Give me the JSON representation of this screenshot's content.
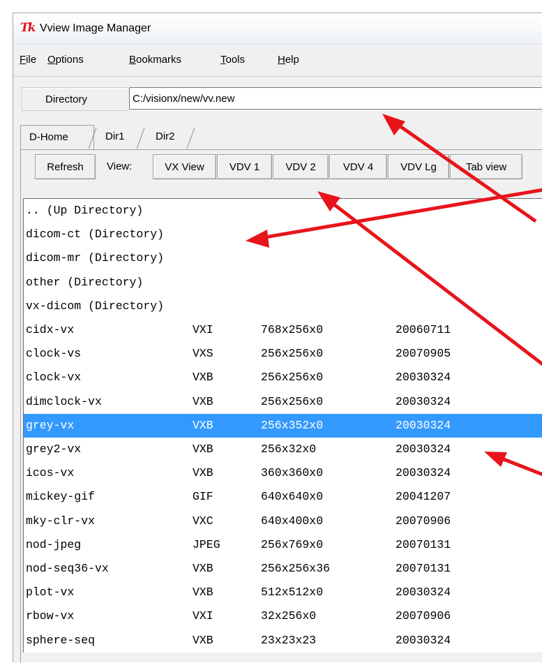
{
  "window": {
    "title": "Vview Image Manager",
    "app_icon": "Tk"
  },
  "menu": [
    {
      "label": "File",
      "accel": "F",
      "rest": "ile"
    },
    {
      "label": "Options",
      "accel": "O",
      "rest": "ptions"
    },
    {
      "label": "Bookmarks",
      "accel": "B",
      "rest": "ookmarks"
    },
    {
      "label": "Tools",
      "accel": "T",
      "rest": "ools"
    },
    {
      "label": "Help",
      "accel": "H",
      "rest": "elp"
    }
  ],
  "directory": {
    "label": "Directory",
    "value": "C:/visionx/new/vv.new"
  },
  "tabs": [
    "D-Home",
    "Dir1",
    "Dir2"
  ],
  "toolbar": {
    "refresh": "Refresh",
    "view_label": "View:",
    "buttons": [
      "VX View",
      "VDV 1",
      "VDV 2",
      "VDV 4",
      "VDV Lg",
      "Tab view"
    ]
  },
  "files": [
    {
      "name": ".. (Up Directory)",
      "type": "",
      "size": "",
      "date": ""
    },
    {
      "name": "dicom-ct (Directory)",
      "type": "",
      "size": "",
      "date": ""
    },
    {
      "name": "dicom-mr (Directory)",
      "type": "",
      "size": "",
      "date": ""
    },
    {
      "name": "other (Directory)",
      "type": "",
      "size": "",
      "date": ""
    },
    {
      "name": "vx-dicom (Directory)",
      "type": "",
      "size": "",
      "date": ""
    },
    {
      "name": "cidx-vx",
      "type": "VXI",
      "size": "768x256x0",
      "date": "20060711"
    },
    {
      "name": "clock-vs",
      "type": "VXS",
      "size": "256x256x0",
      "date": "20070905"
    },
    {
      "name": "clock-vx",
      "type": "VXB",
      "size": "256x256x0",
      "date": "20030324"
    },
    {
      "name": "dimclock-vx",
      "type": "VXB",
      "size": "256x256x0",
      "date": "20030324"
    },
    {
      "name": "grey-vx",
      "type": "VXB",
      "size": "256x352x0",
      "date": "20030324"
    },
    {
      "name": "grey2-vx",
      "type": "VXB",
      "size": "256x32x0",
      "date": "20030324"
    },
    {
      "name": "icos-vx",
      "type": "VXB",
      "size": "360x360x0",
      "date": "20030324"
    },
    {
      "name": "mickey-gif",
      "type": "GIF",
      "size": "640x640x0",
      "date": "20041207"
    },
    {
      "name": "mky-clr-vx",
      "type": "VXC",
      "size": "640x400x0",
      "date": "20070906"
    },
    {
      "name": "nod-jpeg",
      "type": "JPEG",
      "size": "256x769x0",
      "date": "20070131"
    },
    {
      "name": "nod-seq36-vx",
      "type": "VXB",
      "size": "256x256x36",
      "date": "20070131"
    },
    {
      "name": "plot-vx",
      "type": "VXB",
      "size": "512x512x0",
      "date": "20030324"
    },
    {
      "name": "rbow-vx",
      "type": "VXI",
      "size": "32x256x0",
      "date": "20070906"
    },
    {
      "name": "sphere-seq",
      "type": "VXB",
      "size": "23x23x23",
      "date": "20030324"
    }
  ],
  "selected_file": "grey-vx",
  "colors": {
    "selection": "#3399ff",
    "annotation_arrow": "#e8141b"
  }
}
